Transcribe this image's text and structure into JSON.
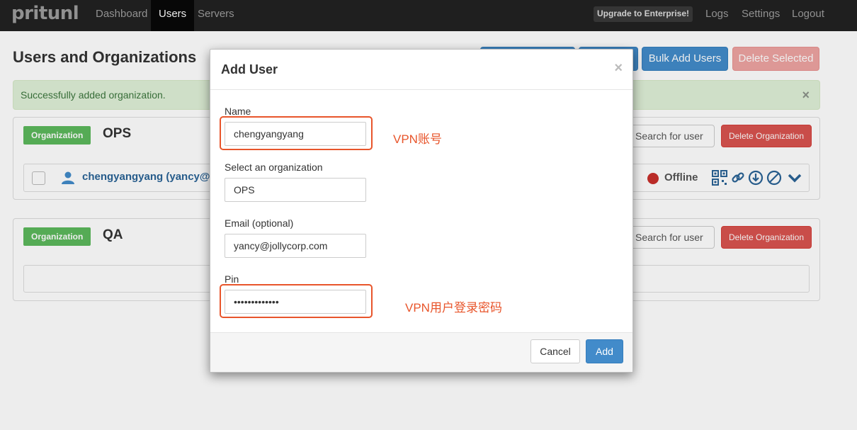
{
  "navbar": {
    "brand": "pritunl",
    "items": [
      "Dashboard",
      "Users",
      "Servers"
    ],
    "upgrade": "Upgrade to Enterprise!",
    "right_items": [
      "Logs",
      "Settings",
      "Logout"
    ]
  },
  "page": {
    "title": "Users and Organizations",
    "buttons": {
      "bulk_add": "Bulk Add Users",
      "delete_selected": "Delete Selected"
    },
    "alert": "Successfully added organization.",
    "alert_close": "×"
  },
  "orgs": [
    {
      "label": "Organization",
      "name": "OPS",
      "search_placeholder": "Search for user",
      "delete": "Delete Organization",
      "users": [
        {
          "name": "chengyangyang (yancy@",
          "status": "Offline"
        }
      ]
    },
    {
      "label": "Organization",
      "name": "QA",
      "search_placeholder": "Search for user",
      "delete": "Delete Organization"
    }
  ],
  "modal": {
    "title": "Add User",
    "close": "×",
    "name_label": "Name",
    "name_value": "chengyangyang",
    "org_label": "Select an organization",
    "org_value": "OPS",
    "email_label": "Email (optional)",
    "email_value": "yancy@jollycorp.com",
    "pin_label": "Pin",
    "pin_value": "•••••••••••••",
    "cancel": "Cancel",
    "add": "Add"
  },
  "annotations": {
    "name_note": "VPN账号",
    "pin_note": "VPN用户登录密码"
  },
  "colors": {
    "annotation": "#e8552b",
    "primary": "#428bca",
    "danger": "#d9534f",
    "success": "#5cb85c"
  }
}
